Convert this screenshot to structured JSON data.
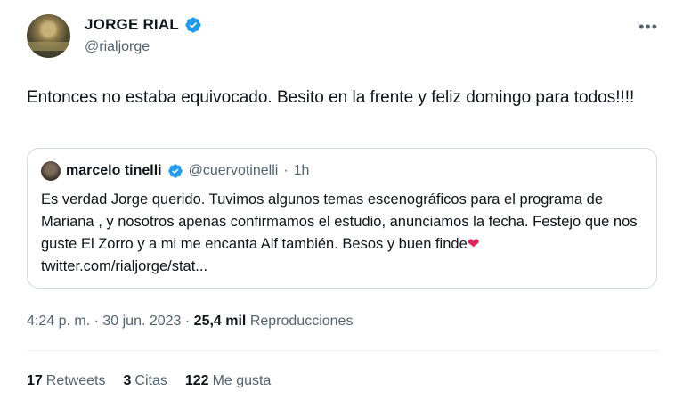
{
  "author": {
    "name": "JORGE RIAL",
    "handle": "@rialjorge",
    "verified_color": "#1d9bf0"
  },
  "menu_icon": "•••",
  "tweet": {
    "text": "Entonces no estaba  equivocado. Besito en la frente y feliz domingo para todos!!!!"
  },
  "quote": {
    "name": "marcelo tinelli",
    "handle": "@cuervotinelli",
    "separator": "·",
    "time": "1h",
    "text": "Es verdad Jorge querido. Tuvimos algunos temas escenográficos para el programa de Mariana , y nosotros apenas confirmamos el estudio, anunciamos la fecha. Festejo que nos guste El Zorro y a mi me encanta Alf también. Besos y buen finde",
    "heart": "❤",
    "link": " twitter.com/rialjorge/stat..."
  },
  "meta": {
    "time": "4:24 p. m.",
    "sep1": " · ",
    "date": "30 jun. 2023",
    "sep2": " · ",
    "views_count": "25,4 mil",
    "views_label": " Reproducciones"
  },
  "stats": {
    "retweets_count": "17",
    "retweets_label": "Retweets",
    "quotes_count": "3",
    "quotes_label": "Citas",
    "likes_count": "122",
    "likes_label": "Me gusta"
  }
}
